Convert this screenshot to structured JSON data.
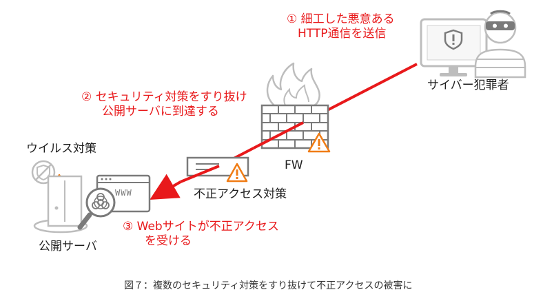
{
  "steps": {
    "step1_num": "①",
    "step1_line1": "細工した悪意ある",
    "step1_line2": "HTTP通信を送信",
    "step2_num": "②",
    "step2_line1": "セキュリティ対策をすり抜け",
    "step2_line2": "公開サーバに到達する",
    "step3_num": "③",
    "step3_line1": "Webサイトが不正アクセス",
    "step3_line2": "を受ける"
  },
  "actors": {
    "criminal": "サイバー犯罪者",
    "firewall": "FW",
    "ids": "不正アクセス対策",
    "antivirus": "ウイルス対策",
    "server": "公開サーバ",
    "browser_text": "WWW"
  },
  "caption": "図７：複数のセキュリティ対策をすり抜けて不正アクセスの被害に",
  "colors": {
    "accent": "#e8191b",
    "warning": "#f07c14",
    "icon": "#c0c0c0",
    "icon_dark": "#7a7a7a"
  }
}
